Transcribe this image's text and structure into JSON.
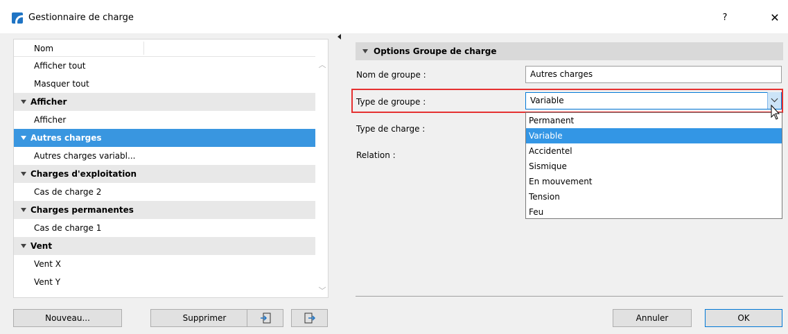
{
  "window": {
    "title": "Gestionnaire de charge",
    "help": "?",
    "close": "✕"
  },
  "tree": {
    "column_header": "Nom",
    "rows": [
      {
        "label": "Afficher tout",
        "type": "item"
      },
      {
        "label": "Masquer tout",
        "type": "item"
      },
      {
        "label": "Afficher",
        "type": "group"
      },
      {
        "label": "Afficher",
        "type": "item"
      },
      {
        "label": "Autres charges",
        "type": "group",
        "selected": true
      },
      {
        "label": "Autres charges variabl...",
        "type": "item"
      },
      {
        "label": "Charges d'exploitation",
        "type": "group"
      },
      {
        "label": "Cas de charge 2",
        "type": "item"
      },
      {
        "label": "Charges permanentes",
        "type": "group"
      },
      {
        "label": "Cas de charge 1",
        "type": "item"
      },
      {
        "label": "Vent",
        "type": "group"
      },
      {
        "label": "Vent X",
        "type": "item"
      },
      {
        "label": "Vent Y",
        "type": "item"
      }
    ]
  },
  "left_buttons": {
    "new": "Nouveau...",
    "delete": "Supprimer"
  },
  "options": {
    "section_title": "Options Groupe de charge",
    "group_name_label": "Nom de groupe :",
    "group_name_value": "Autres charges",
    "group_type_label": "Type de groupe :",
    "group_type_value": "Variable",
    "load_type_label": "Type de charge :",
    "relation_label": "Relation :",
    "group_type_options": [
      "Permanent",
      "Variable",
      "Accidentel",
      "Sismique",
      "En mouvement",
      "Tension",
      "Feu"
    ],
    "group_type_selected_index": 1
  },
  "dialog_buttons": {
    "cancel": "Annuler",
    "ok": "OK"
  },
  "colors": {
    "selection": "#3996e0",
    "highlight": "#e53030"
  }
}
